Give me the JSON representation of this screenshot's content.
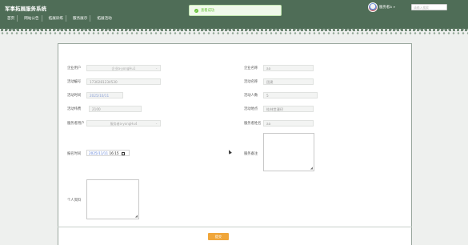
{
  "header": {
    "app_title": "军事拓展服务系统",
    "nav": [
      "首页",
      "网站公告",
      "拓展训练",
      "服务展示",
      "拓展活动"
    ],
    "user_name": "服务者a",
    "search_placeholder": "请输入搜索"
  },
  "toast": {
    "text": "查看成功",
    "icon": "check-circle-icon"
  },
  "form": {
    "company_user_label": "企业用户",
    "company_user_value": "企业a-yongHu1",
    "company_name_label": "企业名称",
    "company_name_value": "aa",
    "activity_no_label": "活动编号",
    "activity_no_value": "1730281234530",
    "activity_name_label": "活动名称",
    "activity_name_value": "团建",
    "activity_time_label": "活动时间",
    "activity_time_value": "2025/10/11",
    "activity_people_label": "活动人数",
    "activity_people_value": "5",
    "activity_cost_label": "活动纬费",
    "activity_cost_value": "2100",
    "activity_place_label": "活动地点",
    "activity_place_value": "桂林世漫印",
    "provider_user_label": "服务者用户",
    "provider_user_value": "服务者a-yongHu4",
    "provider_name_label": "服务者姓名",
    "provider_name_value": "aa",
    "report_time_label": "报名时间",
    "report_time_date": "2025/11/11",
    "report_time_clock": "16:15",
    "service_note_label": "服务备注",
    "personal_info_label": "个人资料",
    "submit_label": "提交"
  }
}
